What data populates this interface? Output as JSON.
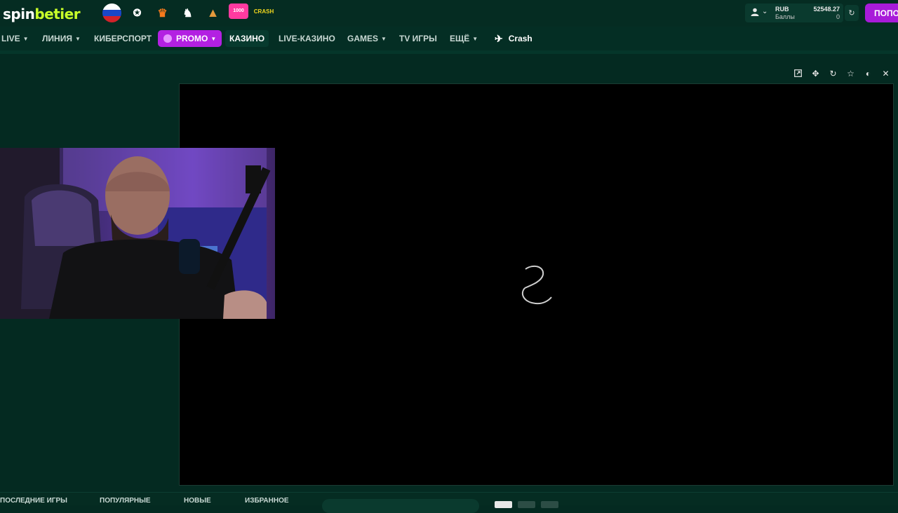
{
  "header": {
    "logo": {
      "part1": "spin",
      "part2": "betier"
    },
    "quick_links": [
      {
        "name": "russia-flag-icon"
      },
      {
        "name": "champions-league-icon"
      },
      {
        "name": "europa-league-icon"
      },
      {
        "name": "premier-league-icon"
      },
      {
        "name": "pyramid-icon"
      },
      {
        "name": "promo-1000-icon",
        "text": "1000"
      },
      {
        "name": "crash-game-icon",
        "text": "CRASH"
      }
    ],
    "account": {
      "currency": "RUB",
      "points_label": "Баллы",
      "balance": "52548.27",
      "points": "0"
    },
    "deposit_label": "ПОПОЛНИТЬ"
  },
  "nav": {
    "items": [
      {
        "label": "LIVE",
        "caret": true
      },
      {
        "label": "ЛИНИЯ",
        "caret": true
      },
      {
        "label": "КИБЕРСПОРТ",
        "caret": false
      },
      {
        "label": "PROMO",
        "caret": true
      },
      {
        "label": "КАЗИНО",
        "caret": false
      },
      {
        "label": "LIVE-КАЗИНО",
        "caret": false
      },
      {
        "label": "GAMES",
        "caret": true
      },
      {
        "label": "TV ИГРЫ",
        "caret": false
      },
      {
        "label": "ЕЩЁ",
        "caret": true
      },
      {
        "label": "Crash",
        "caret": false
      }
    ]
  },
  "game_toolbar": [
    "open-external-icon",
    "move-icon",
    "reload-icon",
    "favorite-star-icon",
    "theme-toggle-icon",
    "close-icon"
  ],
  "bottom_bar": {
    "items": [
      "ПОСЛЕДНИЕ ИГРЫ",
      "ПОПУЛЯРНЫЕ",
      "НОВЫЕ",
      "ИЗБРАННОЕ"
    ]
  },
  "colors": {
    "background": "#042a21",
    "accent_purple": "#a81bd9",
    "logo_green": "#c9ff2a"
  }
}
